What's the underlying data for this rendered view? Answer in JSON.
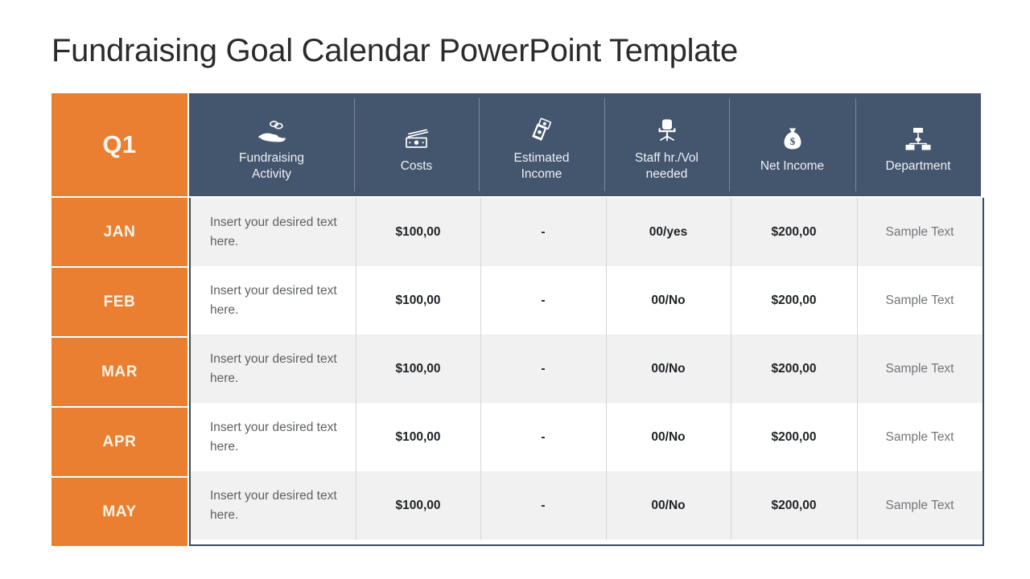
{
  "slide": {
    "title": "Fundraising Goal Calendar PowerPoint Template",
    "colors": {
      "orange": "#EA7F31",
      "header_slate": "#44556E",
      "row_alt": "#F1F1F1",
      "row_base": "#FFFFFF",
      "title_text": "#2B2B2B",
      "border": "#3C4A5E"
    }
  },
  "table": {
    "quarter_label": "Q1",
    "columns": [
      {
        "label": "Fundraising\nActivity",
        "label_line1": "Fundraising",
        "label_line2": "Activity",
        "icon": "hand-holding-money-icon"
      },
      {
        "label": "Costs",
        "label_line1": "Costs",
        "label_line2": "",
        "icon": "banknotes-icon"
      },
      {
        "label": "Estimated\nIncome",
        "label_line1": "Estimated",
        "label_line2": "Income",
        "icon": "tilted-bills-icon"
      },
      {
        "label": "Staff hr./Vol\nneeded",
        "label_line1": "Staff hr./Vol",
        "label_line2": "needed",
        "icon": "office-chair-icon"
      },
      {
        "label": "Net Income",
        "label_line1": "Net Income",
        "label_line2": "",
        "icon": "money-bag-icon"
      },
      {
        "label": "Department",
        "label_line1": "Department",
        "label_line2": "",
        "icon": "org-chart-icon"
      }
    ],
    "rows": [
      {
        "month": "JAN",
        "activity": "Insert your desired text here.",
        "costs": "$100,00",
        "estimated_income": "-",
        "staff": "00/yes",
        "net_income": "$200,00",
        "department": "Sample Text"
      },
      {
        "month": "FEB",
        "activity": "Insert your desired text here.",
        "costs": "$100,00",
        "estimated_income": "-",
        "staff": "00/No",
        "net_income": "$200,00",
        "department": "Sample Text"
      },
      {
        "month": "MAR",
        "activity": "Insert your desired text here.",
        "costs": "$100,00",
        "estimated_income": "-",
        "staff": "00/No",
        "net_income": "$200,00",
        "department": "Sample Text"
      },
      {
        "month": "APR",
        "activity": "Insert your desired text here.",
        "costs": "$100,00",
        "estimated_income": "-",
        "staff": "00/No",
        "net_income": "$200,00",
        "department": "Sample Text"
      },
      {
        "month": "MAY",
        "activity": "Insert your desired text here.",
        "costs": "$100,00",
        "estimated_income": "-",
        "staff": "00/No",
        "net_income": "$200,00",
        "department": "Sample Text"
      }
    ]
  }
}
